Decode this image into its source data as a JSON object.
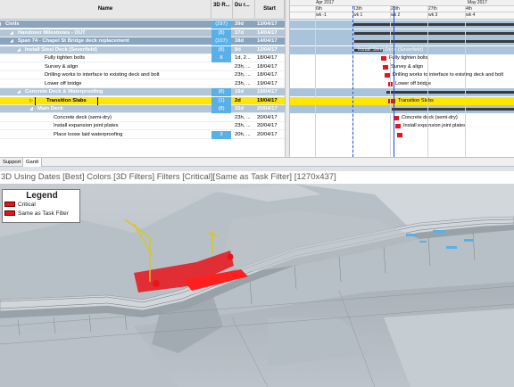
{
  "grid": {
    "headers": {
      "name": "Name",
      "r": "3D R...",
      "d": "Du r...",
      "s": "Start"
    },
    "rows": [
      {
        "indent": 4,
        "marker": "◢",
        "name": "Civils",
        "r": "(297)",
        "d": "39d",
        "s": "13/04/17",
        "style": "summary"
      },
      {
        "indent": 18,
        "marker": "◢",
        "name": "Handover Milestones - OUT",
        "r": "(8)",
        "d": "37d",
        "s": "14/04/17",
        "style": "group"
      },
      {
        "indent": 18,
        "marker": "◢",
        "name": "Span 74 - Chapel St Bridge deck replacement",
        "r": "(107)",
        "d": "38d",
        "s": "14/04/17",
        "style": "summary"
      },
      {
        "indent": 26,
        "marker": "◢",
        "name": "Install Steel Deck (Severfield)",
        "r": "(8)",
        "d": "8d",
        "s": "12/04/17",
        "style": "group"
      },
      {
        "indent": 48,
        "marker": "",
        "name": "Fully tighten bolts",
        "r": "8",
        "d": "1d, 2...",
        "s": "18/04/17",
        "style": "task"
      },
      {
        "indent": 48,
        "marker": "",
        "name": "Survey & align",
        "r": "",
        "d": "23h, ...",
        "s": "18/04/17",
        "style": "task"
      },
      {
        "indent": 48,
        "marker": "",
        "name": "Drilling works to interface to existing deck and bolt",
        "r": "",
        "d": "23h, ...",
        "s": "18/04/17",
        "style": "task"
      },
      {
        "indent": 48,
        "marker": "",
        "name": "Lower off bridge",
        "r": "",
        "d": "23h, ...",
        "s": "19/04/17",
        "style": "task"
      },
      {
        "indent": 26,
        "marker": "◢",
        "name": "Concrete Deck & Waterproofing",
        "r": "(8)",
        "d": "16d",
        "s": "19/04/17",
        "style": "group"
      },
      {
        "indent": 40,
        "marker": "▷",
        "name": "Transition Slabs",
        "r": "(1)",
        "d": "2d",
        "s": "19/04/17",
        "style": "highlight"
      },
      {
        "indent": 40,
        "marker": "◢",
        "name": "Main Deck",
        "r": "(8)",
        "d": "32d",
        "s": "20/04/17",
        "style": "group"
      },
      {
        "indent": 58,
        "marker": "",
        "name": "Concrete deck (semi-dry)",
        "r": "",
        "d": "23h, ...",
        "s": "20/04/17",
        "style": "task"
      },
      {
        "indent": 58,
        "marker": "",
        "name": "Install expansion joint plates",
        "r": "",
        "d": "23h, ...",
        "s": "20/04/17",
        "style": "task"
      },
      {
        "indent": 58,
        "marker": "",
        "name": "Place loose laid waterproofing",
        "r": "3",
        "d": "20h, ...",
        "s": "20/04/17",
        "style": "task"
      }
    ]
  },
  "timeline": {
    "months": [
      {
        "label": "Apr 2017"
      },
      {
        "label": "May 2017"
      }
    ],
    "weeks": [
      "6th",
      "13th",
      "20th",
      "27th",
      "4th"
    ],
    "wk": [
      "wk -1",
      "wk 1",
      "wk 2",
      "wk 3",
      "wk 4"
    ],
    "bars": [
      {
        "row": 0,
        "kind": "summary",
        "label": ""
      },
      {
        "row": 1,
        "kind": "summary",
        "label": ""
      },
      {
        "row": 2,
        "kind": "summary",
        "label": ""
      },
      {
        "row": 3,
        "kind": "summary",
        "label": "Install Steel Deck (Severfield)"
      },
      {
        "row": 4,
        "kind": "task",
        "label": "Fully tighten bolts"
      },
      {
        "row": 5,
        "kind": "task",
        "label": "Survey & align"
      },
      {
        "row": 6,
        "kind": "task",
        "label": "Drilling works to interface to existing deck and bolt"
      },
      {
        "row": 7,
        "kind": "task",
        "label": "Lower off bridge"
      },
      {
        "row": 8,
        "kind": "summary",
        "label": ""
      },
      {
        "row": 9,
        "kind": "task",
        "label": "Transition Slabs"
      },
      {
        "row": 10,
        "kind": "summary",
        "label": ""
      },
      {
        "row": 11,
        "kind": "task",
        "label": "Concrete deck (semi-dry)"
      },
      {
        "row": 12,
        "kind": "task",
        "label": "Install expansion joint plates"
      },
      {
        "row": 13,
        "kind": "task",
        "label": ""
      }
    ]
  },
  "tabs": [
    {
      "label": "Support"
    },
    {
      "label": "Gantt"
    }
  ],
  "viewer": {
    "title": "3D Using Dates [Best] Colors [3D Filters] Filters [Critical][Same as Task Filter] [1270x437]",
    "legend": {
      "title": "Legend",
      "items": [
        {
          "label": "Critical",
          "color": "#e8141a"
        },
        {
          "label": "Same as Task Filter",
          "color": "#e8141a"
        }
      ]
    }
  },
  "colors": {
    "summary_row": "#8aa4bd",
    "group_row": "#b3c6d8",
    "highlight_row": "#ffe600",
    "badge": "#5ab0e6",
    "critical": "#e8141a",
    "today_line": "#1c4fd8",
    "chart_band": "#a9c3da"
  }
}
